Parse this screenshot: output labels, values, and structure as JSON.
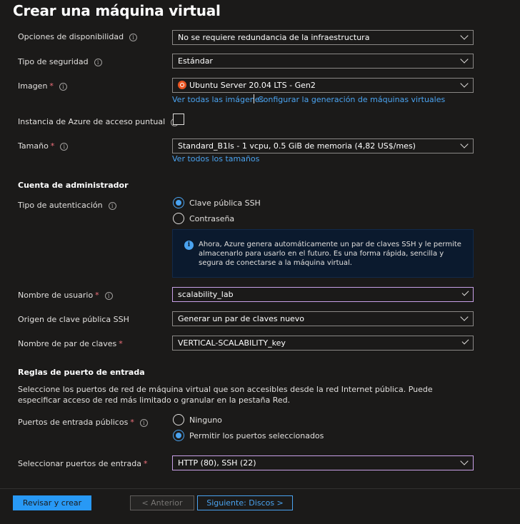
{
  "header": {
    "title": "Crear una máquina virtual",
    "more": "···"
  },
  "fields": {
    "availability": {
      "label": "Opciones de disponibilidad",
      "value": "No se requiere redundancia de la infraestructura"
    },
    "security": {
      "label": "Tipo de seguridad",
      "value": "Estándar"
    },
    "image": {
      "label": "Imagen",
      "value": "Ubuntu Server 20.04 LTS - Gen2",
      "link_all": "Ver todas las imágenes",
      "link_config": "Configurar la generación de máquinas virtuales"
    },
    "spot": {
      "label": "Instancia de Azure de acceso puntual"
    },
    "size": {
      "label": "Tamaño",
      "value": "Standard_B1ls - 1 vcpu, 0.5 GiB de memoria (4,82 US$/mes)",
      "link_all": "Ver todos los tamaños"
    }
  },
  "admin": {
    "heading": "Cuenta de administrador",
    "auth_label": "Tipo de autenticación",
    "auth_options": [
      "Clave pública SSH",
      "Contraseña"
    ],
    "info_text": "Ahora, Azure genera automáticamente un par de claves SSH y le permite almacenarlo para usarlo en el futuro. Es una forma rápida, sencilla y segura de conectarse a la máquina virtual.",
    "username_label": "Nombre de usuario",
    "username_value": "scalability_lab",
    "ssh_source_label": "Origen de clave pública SSH",
    "ssh_source_value": "Generar un par de claves nuevo",
    "keypair_label": "Nombre de par de claves",
    "keypair_value": "VERTICAL-SCALABILITY_key"
  },
  "ports": {
    "heading": "Reglas de puerto de entrada",
    "description": "Seleccione los puertos de red de máquina virtual que son accesibles desde la red Internet pública. Puede especificar acceso de red más limitado o granular en la pestaña Red.",
    "public_label": "Puertos de entrada públicos",
    "public_options": [
      "Ninguno",
      "Permitir los puertos seleccionados"
    ],
    "select_label": "Seleccionar puertos de entrada",
    "select_value": "HTTP (80), SSH (22)"
  },
  "footer": {
    "review": "Revisar y crear",
    "previous": "< Anterior",
    "next": "Siguiente: Discos >"
  },
  "symbols": {
    "required": "*",
    "info": "i"
  },
  "colors": {
    "accent": "#2899f5",
    "link": "#4aa3f0",
    "required": "#f1707b",
    "focus_border": "#c9a1e8"
  }
}
